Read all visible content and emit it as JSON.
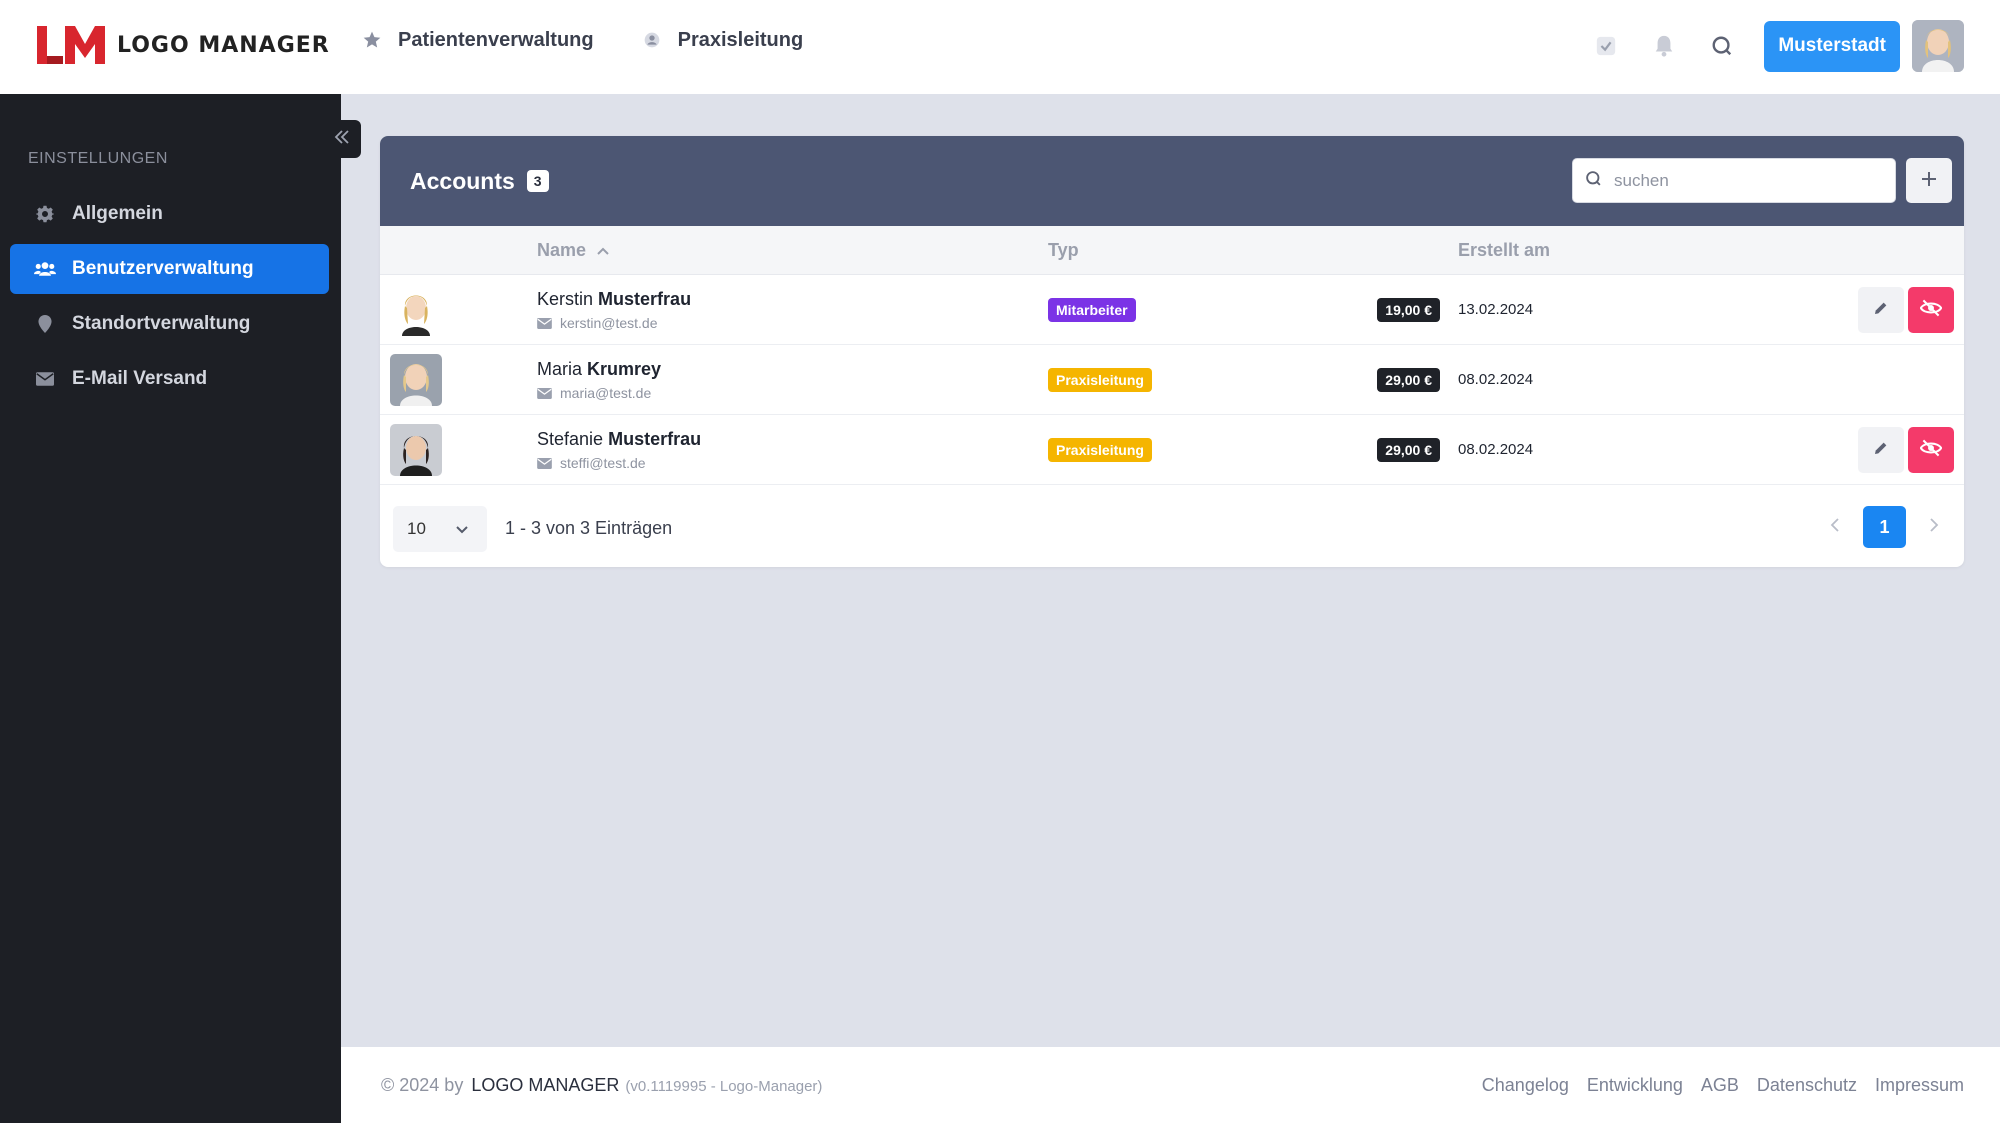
{
  "app": {
    "logo_text": "LOGO MANAGER",
    "logo_mark": "LM"
  },
  "topnav": {
    "items": [
      {
        "label": "Patientenverwaltung",
        "icon": "star-icon"
      },
      {
        "label": "Praxisleitung",
        "icon": "user-circle-icon"
      }
    ],
    "location_button": "Musterstadt"
  },
  "sidebar": {
    "heading": "EINSTELLUNGEN",
    "items": [
      {
        "label": "Allgemein",
        "icon": "gear-icon",
        "active": false
      },
      {
        "label": "Benutzerverwaltung",
        "icon": "users-icon",
        "active": true
      },
      {
        "label": "Standortverwaltung",
        "icon": "map-pin-icon",
        "active": false
      },
      {
        "label": "E-Mail Versand",
        "icon": "envelope-icon",
        "active": false
      }
    ]
  },
  "accounts": {
    "title": "Accounts",
    "count": "3",
    "search_placeholder": "suchen",
    "columns": {
      "name": "Name",
      "type": "Typ",
      "created": "Erstellt am"
    },
    "rows": [
      {
        "first": "Kerstin",
        "last": "Musterfrau",
        "email": "kerstin@test.de",
        "type": "Mitarbeiter",
        "type_class": "mitarbeiter",
        "price": "19,00 €",
        "date": "13.02.2024",
        "actions": true
      },
      {
        "first": "Maria",
        "last": "Krumrey",
        "email": "maria@test.de",
        "type": "Praxisleitung",
        "type_class": "praxis",
        "price": "29,00 €",
        "date": "08.02.2024",
        "actions": false
      },
      {
        "first": "Stefanie",
        "last": "Musterfrau",
        "email": "steffi@test.de",
        "type": "Praxisleitung",
        "type_class": "praxis",
        "price": "29,00 €",
        "date": "08.02.2024",
        "actions": true
      }
    ],
    "per_page": "10",
    "range_text": "1 - 3 von 3 Einträgen",
    "current_page": "1"
  },
  "footer": {
    "copyright": "© 2024 by",
    "brand": "LOGO MANAGER",
    "version": "(v0.1119995 - Logo-Manager)",
    "links": [
      "Changelog",
      "Entwicklung",
      "AGB",
      "Datenschutz",
      "Impressum"
    ]
  },
  "colors": {
    "primary": "#1673e6",
    "header_bar": "#4c5673",
    "sidebar_bg": "#1d1f25",
    "mitarbeiter": "#7b33e6",
    "praxisleitung": "#f5b500",
    "danger": "#f43a6a"
  }
}
